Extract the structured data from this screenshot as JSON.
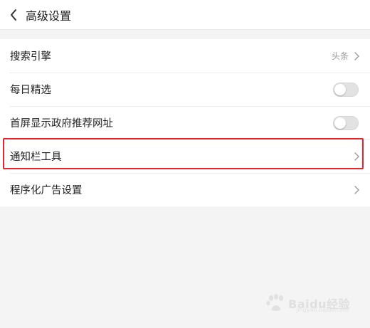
{
  "header": {
    "title": "高级设置",
    "back_icon": "chevron-left-icon"
  },
  "settings": {
    "items": [
      {
        "label": "搜索引擎",
        "value": "头条",
        "control": "chevron"
      },
      {
        "label": "每日精选",
        "control": "toggle",
        "on": false
      },
      {
        "label": "首屏显示政府推荐网址",
        "control": "toggle",
        "on": false
      },
      {
        "label": "通知栏工具",
        "control": "chevron"
      },
      {
        "label": "程序化广告设置",
        "control": "chevron"
      }
    ]
  },
  "watermark": {
    "text": "Baidu经验",
    "sub": "jingyan.baidu.com"
  },
  "colors": {
    "highlight": "#e3262b",
    "background": "#f4f4f4",
    "toggle_off": "#e2e2e2"
  }
}
